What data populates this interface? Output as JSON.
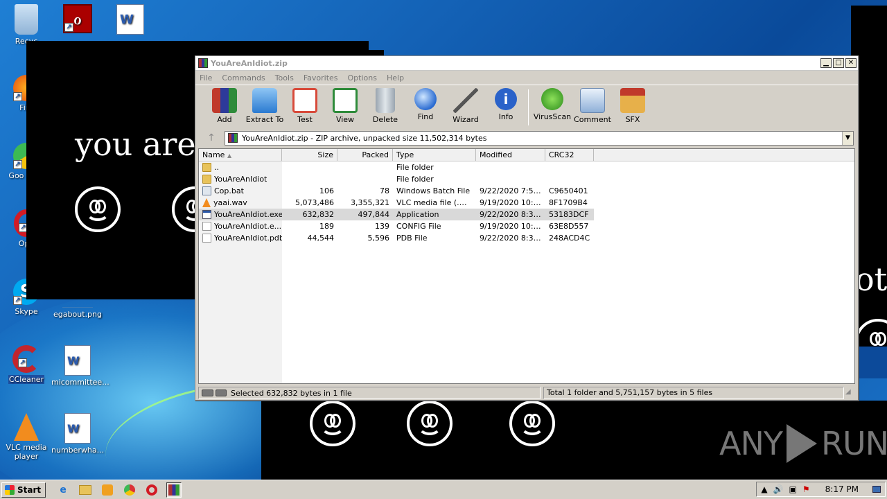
{
  "desktop": {
    "icons": [
      {
        "label": "Recyc",
        "icon": "recycle-bin-icon"
      },
      {
        "label": "",
        "icon": "acrobat-icon"
      },
      {
        "label": "",
        "icon": "word-icon"
      },
      {
        "label": "Fire",
        "icon": "firefox-icon"
      },
      {
        "label": "Goo Chro",
        "icon": "chrome-icon"
      },
      {
        "label": "Ope",
        "icon": "opera-icon"
      },
      {
        "label": "Skype",
        "icon": "skype-icon"
      },
      {
        "label": "egabout.png",
        "icon": "image-file-icon"
      },
      {
        "label": "CCleaner",
        "icon": "ccleaner-icon"
      },
      {
        "label": "micommittee...",
        "icon": "word-doc-icon"
      },
      {
        "label": "VLC media player",
        "icon": "vlc-icon"
      },
      {
        "label": "numberwha...",
        "icon": "word-doc-icon"
      }
    ]
  },
  "idiot_window": {
    "text": "you are",
    "text_right": "ot"
  },
  "winrar": {
    "title": "YouAreAnIdiot.zip",
    "menu": [
      "File",
      "Commands",
      "Tools",
      "Favorites",
      "Options",
      "Help"
    ],
    "toolbar": [
      {
        "label": "Add",
        "icon": "add-icon",
        "color": "#c0392b"
      },
      {
        "label": "Extract To",
        "icon": "extract-to-icon",
        "color": "#3a8fd9"
      },
      {
        "label": "Test",
        "icon": "test-icon",
        "color": "#d84a3a"
      },
      {
        "label": "View",
        "icon": "view-icon",
        "color": "#2e8b3a"
      },
      {
        "label": "Delete",
        "icon": "delete-icon",
        "color": "#8f9aa5"
      },
      {
        "label": "Find",
        "icon": "find-icon",
        "color": "#2a6bd1"
      },
      {
        "label": "Wizard",
        "icon": "wizard-icon",
        "color": "#7a7a9a"
      },
      {
        "label": "Info",
        "icon": "info-icon",
        "color": "#2a62c9"
      },
      {
        "label": "VirusScan",
        "icon": "virusscan-icon",
        "color": "#3aa02a"
      },
      {
        "label": "Comment",
        "icon": "comment-icon",
        "color": "#8fb0d8"
      },
      {
        "label": "SFX",
        "icon": "sfx-icon",
        "color": "#d9a83a"
      }
    ],
    "address": "YouAreAnIdiot.zip - ZIP archive, unpacked size 11,502,314 bytes",
    "columns": [
      "Name",
      "Size",
      "Packed",
      "Type",
      "Modified",
      "CRC32"
    ],
    "files": [
      {
        "name": "..",
        "size": "",
        "packed": "",
        "type": "File folder",
        "modified": "",
        "crc": "",
        "icon": "folder"
      },
      {
        "name": "YouAreAnIdiot",
        "size": "",
        "packed": "",
        "type": "File folder",
        "modified": "",
        "crc": "",
        "icon": "folder"
      },
      {
        "name": "Cop.bat",
        "size": "106",
        "packed": "78",
        "type": "Windows Batch File",
        "modified": "9/22/2020 7:53...",
        "crc": "C9650401",
        "icon": "bat"
      },
      {
        "name": "yaai.wav",
        "size": "5,073,486",
        "packed": "3,355,321",
        "type": "VLC media file (.wav)",
        "modified": "9/19/2020 10:4...",
        "crc": "8F1709B4",
        "icon": "wav"
      },
      {
        "name": "YouAreAnIdiot.exe",
        "size": "632,832",
        "packed": "497,844",
        "type": "Application",
        "modified": "9/22/2020 8:30...",
        "crc": "53183DCF",
        "icon": "exe",
        "selected": true
      },
      {
        "name": "YouAreAnIdiot.e...",
        "size": "189",
        "packed": "139",
        "type": "CONFIG File",
        "modified": "9/19/2020 10:5...",
        "crc": "63E8D557",
        "icon": "doc"
      },
      {
        "name": "YouAreAnIdiot.pdb",
        "size": "44,544",
        "packed": "5,596",
        "type": "PDB File",
        "modified": "9/22/2020 8:30...",
        "crc": "248ACD4C",
        "icon": "doc"
      }
    ],
    "status_left": "Selected 632,832 bytes in 1 file",
    "status_right": "Total 1 folder and 5,751,157 bytes in 5 files"
  },
  "taskbar": {
    "start": "Start",
    "quicklaunch": [
      "ie-icon",
      "explorer-icon",
      "media-player-icon",
      "chrome-icon",
      "opera-icon",
      "winrar-icon"
    ],
    "clock": "8:17 PM"
  },
  "watermark": {
    "left": "ANY",
    "right": "RUN"
  }
}
